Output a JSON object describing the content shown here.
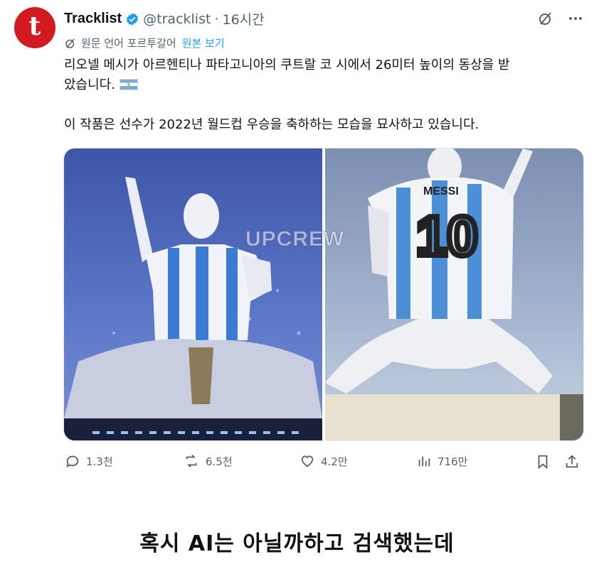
{
  "author": {
    "name": "Tracklist",
    "handle": "@tracklist",
    "time": "16시간",
    "avatar_letter": "t"
  },
  "translation": {
    "label": "원문 언어 포르투갈어",
    "show_original": "원본 보기"
  },
  "tweet": {
    "line1": "리오넬 메시가 아르헨티나 파타고니아의 쿠트랄 코 시에서 26미터 높이의 동상을 받",
    "line2": "았습니다.",
    "line3": "이 작품은 선수가 2022년 월드컵 우승을 축하하는 모습을 묘사하고 있습니다."
  },
  "media": {
    "watermark": "UPCREW",
    "jersey_name": "MESSI",
    "jersey_number": "10"
  },
  "actions": {
    "replies": "1.3천",
    "reposts": "6.5천",
    "likes": "4.2만",
    "views": "716만"
  },
  "caption": "혹시 AI는 아닐까하고 검색했는데",
  "colors": {
    "brand_red": "#d31a20",
    "link_blue": "#1d9bf0",
    "muted": "#536471"
  }
}
